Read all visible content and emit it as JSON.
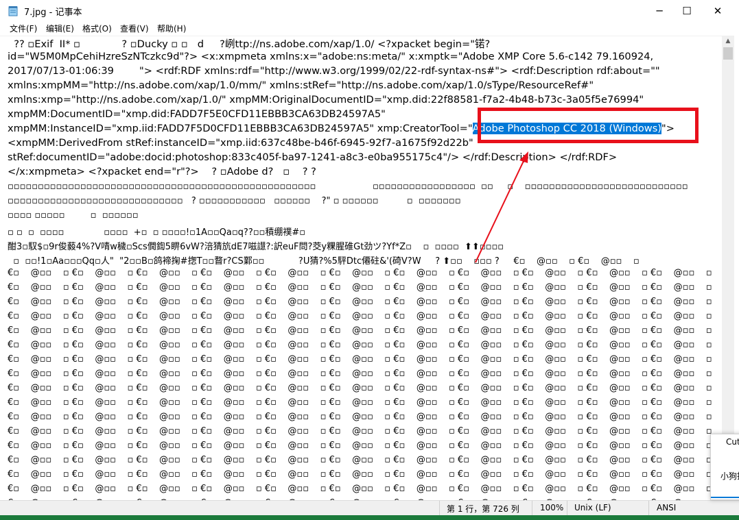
{
  "window": {
    "title": "7.jpg - 记事本"
  },
  "window_controls": {
    "minimize": "─",
    "maximize": "☐",
    "close": "✕"
  },
  "menu": [
    "文件(F)",
    "编辑(E)",
    "格式(O)",
    "查看(V)",
    "帮助(H)"
  ],
  "content": {
    "lines": [
      "  ?? ▫Exif  II* ▫             ? ▫Ducky ▫ ▫   d     ?峢ttp://ns.adobe.com/xap/1.0/ <?xpacket begin=\"锘?",
      "id=\"W5M0MpCehiHzreSzNTczkc9d\"?> <x:xmpmeta xmlns:x=\"adobe:ns:meta/\" x:xmptk=\"Adobe XMP Core 5.6-c142 79.160924,",
      "2017/07/13-01:06:39        \"> <rdf:RDF xmlns:rdf=\"http://www.w3.org/1999/02/22-rdf-syntax-ns#\"> <rdf:Description rdf:about=\"\"",
      "xmlns:xmpMM=\"http://ns.adobe.com/xap/1.0/mm/\" xmlns:stRef=\"http://ns.adobe.com/xap/1.0/sType/ResourceRef#\"",
      "xmlns:xmp=\"http://ns.adobe.com/xap/1.0/\" xmpMM:OriginalDocumentID=\"xmp.did:22f88581-f7a2-4b48-b73c-3a05f5e76994\"",
      "xmpMM:DocumentID=\"xmp.did:FADD7F5E0CFD11EBBB3CA63DB24597A5\"",
      null,
      "<xmpMM:DerivedFrom stRef:instanceID=\"xmp.iid:637c48be-b46f-6945-92f7-a1675f92d22b\"",
      "stRef:documentID=\"adobe:docid:photoshop:833c405f-ba97-1241-a8c3-e0ba955175c4\"/> </rdf:Description> </rdf:RDF>",
      "</x:xmpmeta> <?xpacket end=\"r\"?>    ? ▫Adobe d?   ▫    ? ?",
      "▫▫▫▫▫▫▫▫▫▫▫▫▫▫▫▫▫▫▫▫▫▫▫▫▫▫▫▫▫▫▫▫▫▫▫▫▫▫▫▫▫▫▫▫▫▫▫▫▫▫▫                    ▫▫▫▫▫▫▫▫▫▫▫▫▫▫▫▫▫  ▫▫     ▫    ▫▫▫▫▫▫▫▫▫▫▫▫▫▫▫▫▫▫▫▫▫▫▫▫▫▫▫",
      "▫▫▫▫▫▫▫▫▫▫▫▫▫▫▫▫▫▫▫▫▫▫▫▫▫▫▫▫▫   ? ▫▫▫▫▫▫▫▫▫▫▫   ▫▫▫▫▫▫    ?\" ▫ ▫▫▫▫▫▫          ▫  ▫▫▫▫▫▫▫",
      "▫▫▫▫ ▫▫▫▫▫         ▫  ▫▫▫▫▫▫",
      "▫ ▫  ▫  ▫▫▫▫              ▫▫▫▫  +▫  ▫ ▫▫▫▫!▫1A▫▫Qa▫q??▫▫積绷襆#▫",
      "酣3▫馭$▫9r俊藙4%?V啨w穢▫Scs僩鍧5睤6vW?涪猜斻dE7嗞譿?:訳euF問?茭y粿腥碓Gt劲ツ?Yf*Z▫    ▫  ▫▫▫▫  ⬆⬆▫▫▫▫",
      "  ▫  ▫▫!1▫Aa▫▫▫Qq▫人\"  \"2▫▫B▫鸽褅掬#揔T▫▫瞀r?CS鄴▫▫            ?U猜?%5駍Dtc僊砫&'(碕V?W     ? ⬆▫▫    ▫▫▫ ?     €▫    @▫▫    ▫ €▫    @▫▫    ▫",
      "€▫    @▫▫    ▫ €▫    @▫▫    ▫ €▫    @▫▫    ▫ €▫    @▫▫    ▫ €▫    @▫▫    ▫ €▫    @▫▫    ▫ €▫    @▫▫    ▫ €▫    @▫▫    ▫ €▫    @▫▫    ▫ €▫    @▫▫    ▫ €▫    @▫▫    ▫"
    ],
    "line4_prefix": "xmpMM:InstanceID=\"xmp.iid:FADD7F5D0CFD11EBBB3CA63DB24597A5\" xmp:CreatorTool=\"",
    "selected_text": "Adobe Photoshop CC 2018 (Windows)",
    "line4_suffix": "\">",
    "repeat_line": "€▫    @▫▫    ▫ €▫    @▫▫    ▫ €▫    @▫▫    ▫ €▫    @▫▫    ▫ €▫    @▫▫    ▫ €▫    @▫▫    ▫ €▫    @▫▫    ▫ €▫    @▫▫    ▫ €▫    @▫▫    ▫ €▫    @▫▫    ▫ €▫    @▫▫    ▫"
  },
  "statusbar": {
    "position": "第 1 行，第 726 列",
    "zoom": "100%",
    "line_ending": "Unix (LF)",
    "encoding": "ANSI"
  },
  "popup": {
    "title": "Cut",
    "text": "小狗找"
  },
  "colors": {
    "selection": "#0078d7",
    "highlight_box": "#e8101b",
    "arrow": "#e8101b"
  }
}
